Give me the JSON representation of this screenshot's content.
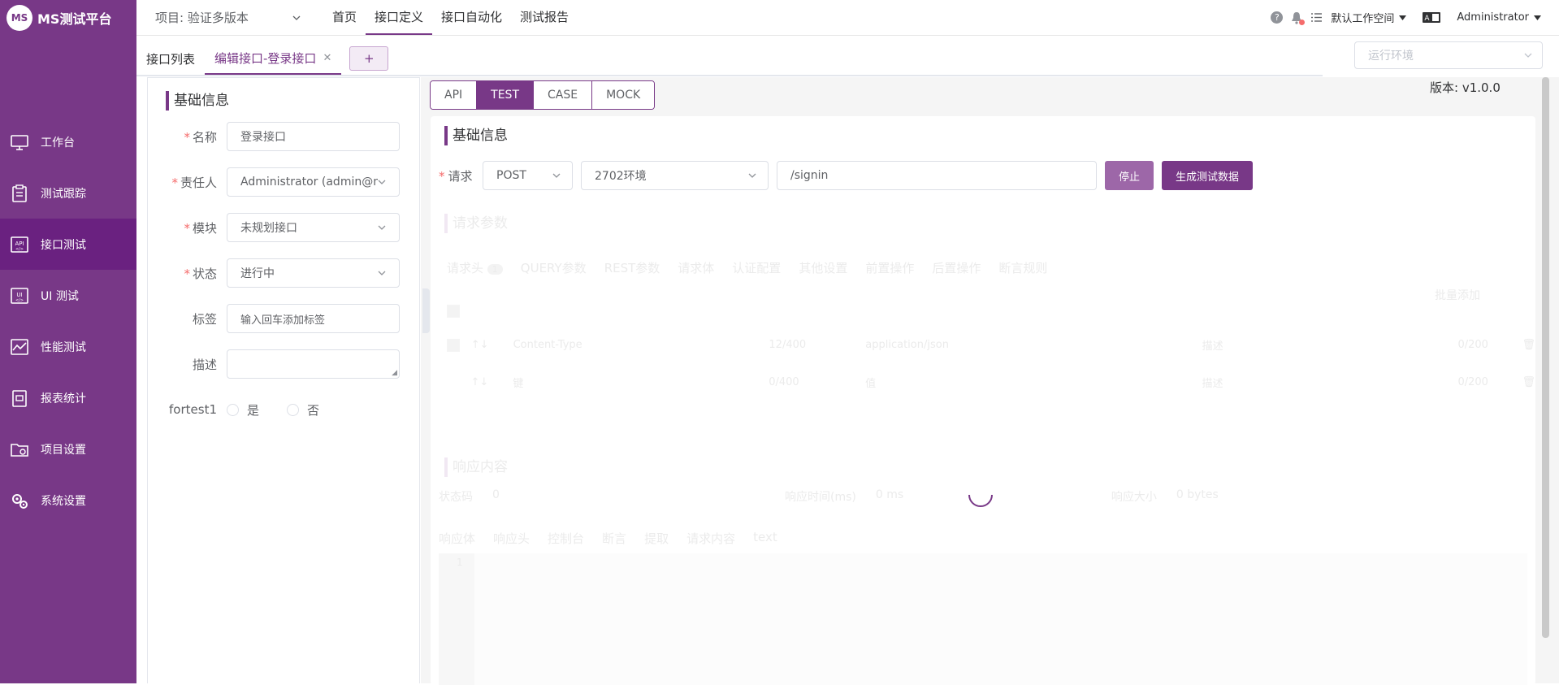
{
  "app": {
    "logo_mark": "MS",
    "name": "MS测试平台"
  },
  "sidebar": {
    "items": [
      {
        "label": "工作台",
        "icon": "monitor-icon"
      },
      {
        "label": "测试跟踪",
        "icon": "clipboard-icon"
      },
      {
        "label": "接口测试",
        "icon": "api-icon",
        "active": true
      },
      {
        "label": "UI 测试",
        "icon": "ui-icon"
      },
      {
        "label": "性能测试",
        "icon": "chart-icon"
      },
      {
        "label": "报表统计",
        "icon": "report-icon"
      },
      {
        "label": "项目设置",
        "icon": "folder-settings-icon"
      },
      {
        "label": "系统设置",
        "icon": "gears-icon"
      }
    ]
  },
  "topbar": {
    "project": "项目: 验证多版本",
    "nav": [
      "首页",
      "接口定义",
      "接口自动化",
      "测试报告"
    ],
    "active_nav": "接口定义",
    "workspace": "默认工作空间",
    "user": "Administrator"
  },
  "tabs": {
    "list": "接口列表",
    "edit": "编辑接口-登录接口",
    "add": "+"
  },
  "env_select": {
    "placeholder": "运行环境"
  },
  "basic_form": {
    "title": "基础信息",
    "name_label": "名称",
    "name_value": "登录接口",
    "owner_label": "责任人",
    "owner_value": "Administrator (admin@m",
    "module_label": "模块",
    "module_value": "未规划接口",
    "status_label": "状态",
    "status_value": "进行中",
    "tags_label": "标签",
    "tags_placeholder": "输入回车添加标签",
    "desc_label": "描述",
    "custom_label": "fortest1",
    "opt_yes": "是",
    "opt_no": "否"
  },
  "mode_tabs": [
    "API",
    "TEST",
    "CASE",
    "MOCK"
  ],
  "active_mode": "TEST",
  "version": "版本: v1.0.0",
  "request": {
    "title": "基础信息",
    "label": "请求",
    "method": "POST",
    "env": "2702环境",
    "url": "/signin",
    "stop_btn": "停止",
    "gen_btn": "生成测试数据"
  },
  "params": {
    "title": "请求参数",
    "tabs": [
      "请求头",
      "QUERY参数",
      "REST参数",
      "请求体",
      "认证配置",
      "其他设置",
      "前置操作",
      "后置操作",
      "断言规则"
    ],
    "header_count": "1",
    "batch_add": "批量添加",
    "row1_key": "Content-Type",
    "row1_count": "12/400",
    "row1_value": "application/json",
    "row1_desc": "描述",
    "row1_desc_count": "0/200",
    "row2_key": "键",
    "row2_count": "0/400",
    "row2_value": "值",
    "row2_desc": "描述",
    "row2_desc_count": "0/200"
  },
  "response": {
    "title": "响应内容",
    "status_label": "状态码",
    "status_value": "0",
    "time_label": "响应时间(ms)",
    "time_value": "0 ms",
    "size_label": "响应大小",
    "size_value": "0 bytes",
    "tabs": [
      "响应体",
      "响应头",
      "控制台",
      "断言",
      "提取",
      "请求内容"
    ],
    "format": "text",
    "line_no": "1"
  }
}
